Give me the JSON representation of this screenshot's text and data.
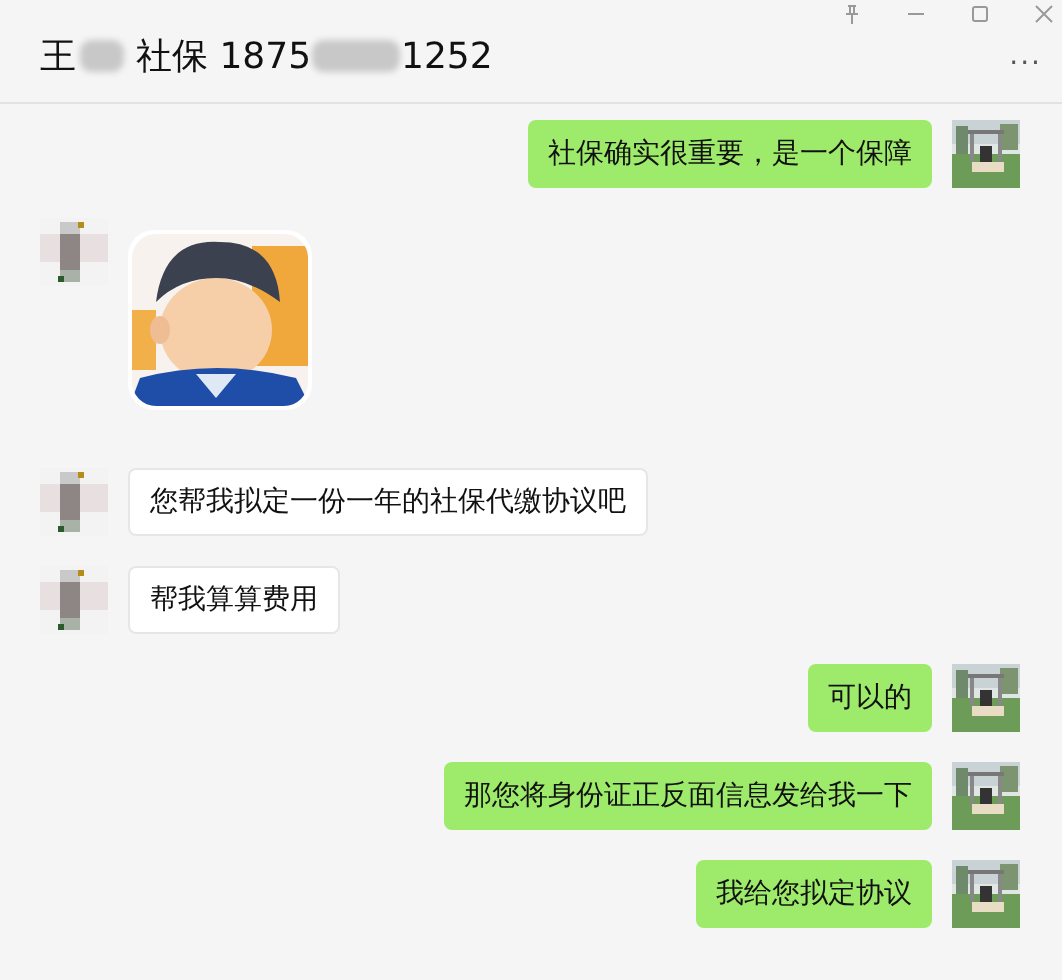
{
  "window": {
    "title_parts": [
      "王",
      "社保 1875",
      "1252"
    ],
    "more": "···"
  },
  "messages": [
    {
      "outgoing": true,
      "kind": "text",
      "text": "社保确实很重要，是一个保障"
    },
    {
      "outgoing": false,
      "kind": "sticker"
    },
    {
      "outgoing": false,
      "kind": "text",
      "text": "您帮我拟定一份一年的社保代缴协议吧"
    },
    {
      "outgoing": false,
      "kind": "text",
      "text": "帮我算算费用"
    },
    {
      "outgoing": true,
      "kind": "text",
      "text": "可以的"
    },
    {
      "outgoing": true,
      "kind": "text",
      "text": "那您将身份证正反面信息发给我一下"
    },
    {
      "outgoing": true,
      "kind": "text",
      "text": "我给您拟定协议"
    }
  ]
}
